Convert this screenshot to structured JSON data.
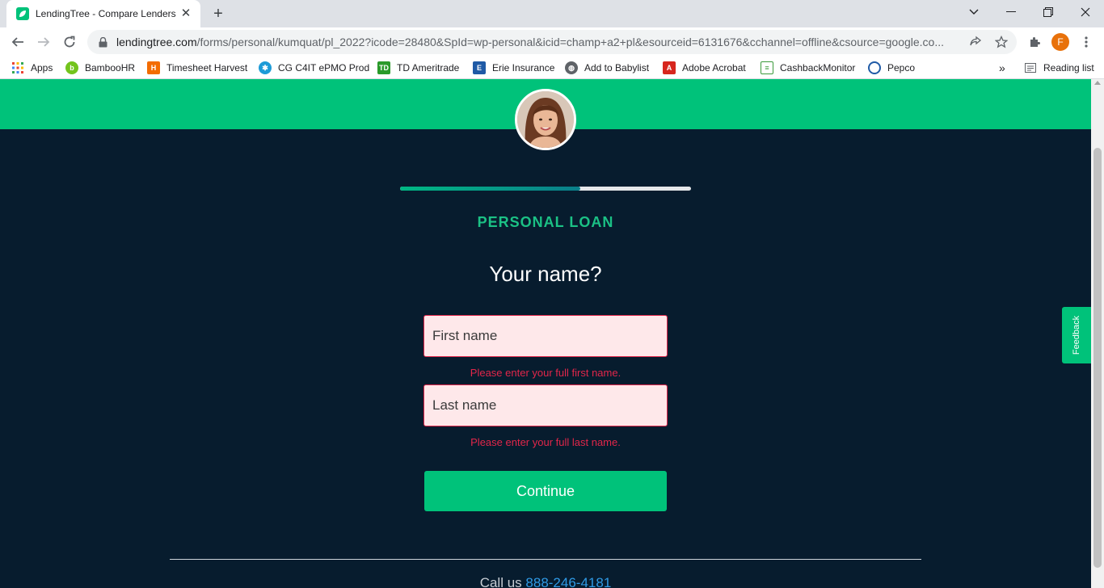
{
  "browser": {
    "tab_title": "LendingTree - Compare Lenders",
    "url_host": "lendingtree.com",
    "url_path": "/forms/personal/kumquat/pl_2022?icode=28480&SpId=wp-personal&icid=champ+a2+pl&esourceid=6131676&cchannel=offline&csource=google.co...",
    "profile_initial": "F",
    "bookmarks": [
      {
        "label": "Apps",
        "icon": "apps-grid-icon"
      },
      {
        "label": "BambooHR",
        "icon": "bamboohr-icon"
      },
      {
        "label": "Timesheet Harvest",
        "icon": "harvest-icon"
      },
      {
        "label": "CG C4IT ePMO Prod",
        "icon": "c4it-icon"
      },
      {
        "label": "TD Ameritrade",
        "icon": "td-icon"
      },
      {
        "label": "Erie Insurance",
        "icon": "erie-icon"
      },
      {
        "label": "Add to Babylist",
        "icon": "globe-icon"
      },
      {
        "label": "Adobe Acrobat",
        "icon": "acrobat-icon"
      },
      {
        "label": "CashbackMonitor",
        "icon": "cashback-icon"
      },
      {
        "label": "Pepco",
        "icon": "pepco-icon"
      }
    ],
    "overflow": "»",
    "reading_list": "Reading list"
  },
  "form": {
    "progress": 0.62,
    "loan_type": "PERSONAL LOAN",
    "question": "Your name?",
    "first_name_placeholder": "First name",
    "first_name_error": "Please enter your full first name.",
    "last_name_placeholder": "Last name",
    "last_name_error": "Please enter your full last name.",
    "continue_label": "Continue"
  },
  "footer": {
    "call_prefix": "Call us",
    "phone": "888-246-4181"
  },
  "feedback_label": "Feedback",
  "colors": {
    "brand_green": "#00c27a",
    "page_bg": "#071c2e",
    "error": "#e2264a",
    "link": "#2f9ae6"
  }
}
